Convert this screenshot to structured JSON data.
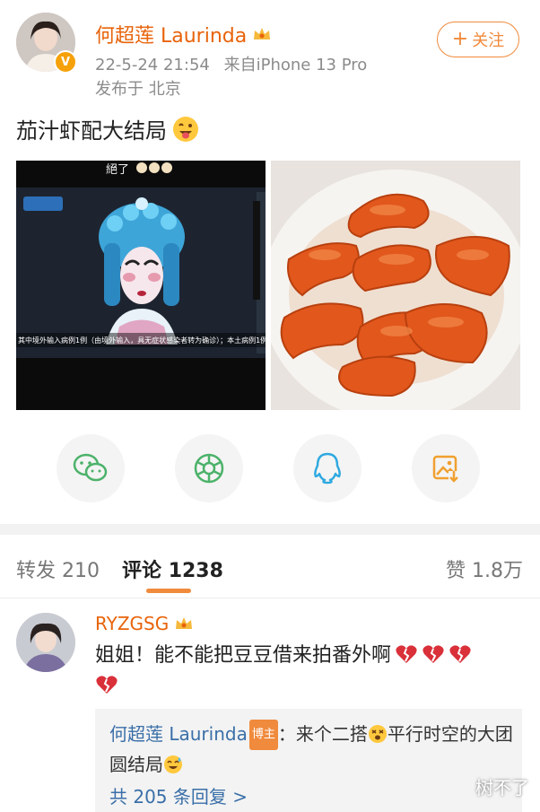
{
  "post": {
    "author_name": "何超莲 Laurinda",
    "date_time": "22-5-24 21:54",
    "source": "来自iPhone 13 Pro",
    "location": "发布于 北京",
    "follow_label": "关注",
    "text": "茄汁虾配大结局",
    "image1_caption_top": "絕了",
    "image1_subtitle": "其中境外输入病例1例（由境外输入，具无症状感染者转为确诊）；本土病例1例",
    "image2_alt": "shrimp"
  },
  "share": {
    "icons": [
      "wechat-icon",
      "moments-icon",
      "qq-icon",
      "save-image-icon"
    ]
  },
  "tabs": {
    "repost_label": "转发",
    "repost_count": "210",
    "comment_label": "评论",
    "comment_count": "1238",
    "like_label": "赞",
    "like_count": "1.8万"
  },
  "comment": {
    "user": "RYZGSG",
    "text": "姐姐！能不能把豆豆借来拍番外啊"
  },
  "reply": {
    "name": "何超莲 Laurinda",
    "badge": "博主",
    "text_a": "：来个二搭",
    "text_b": "平行时空的大团圆结局",
    "more": "共 205 条回复 >"
  },
  "watermark": "树不了",
  "colors": {
    "accent": "#f08a3c",
    "name": "#e8630a",
    "link": "#3a6fa8"
  }
}
